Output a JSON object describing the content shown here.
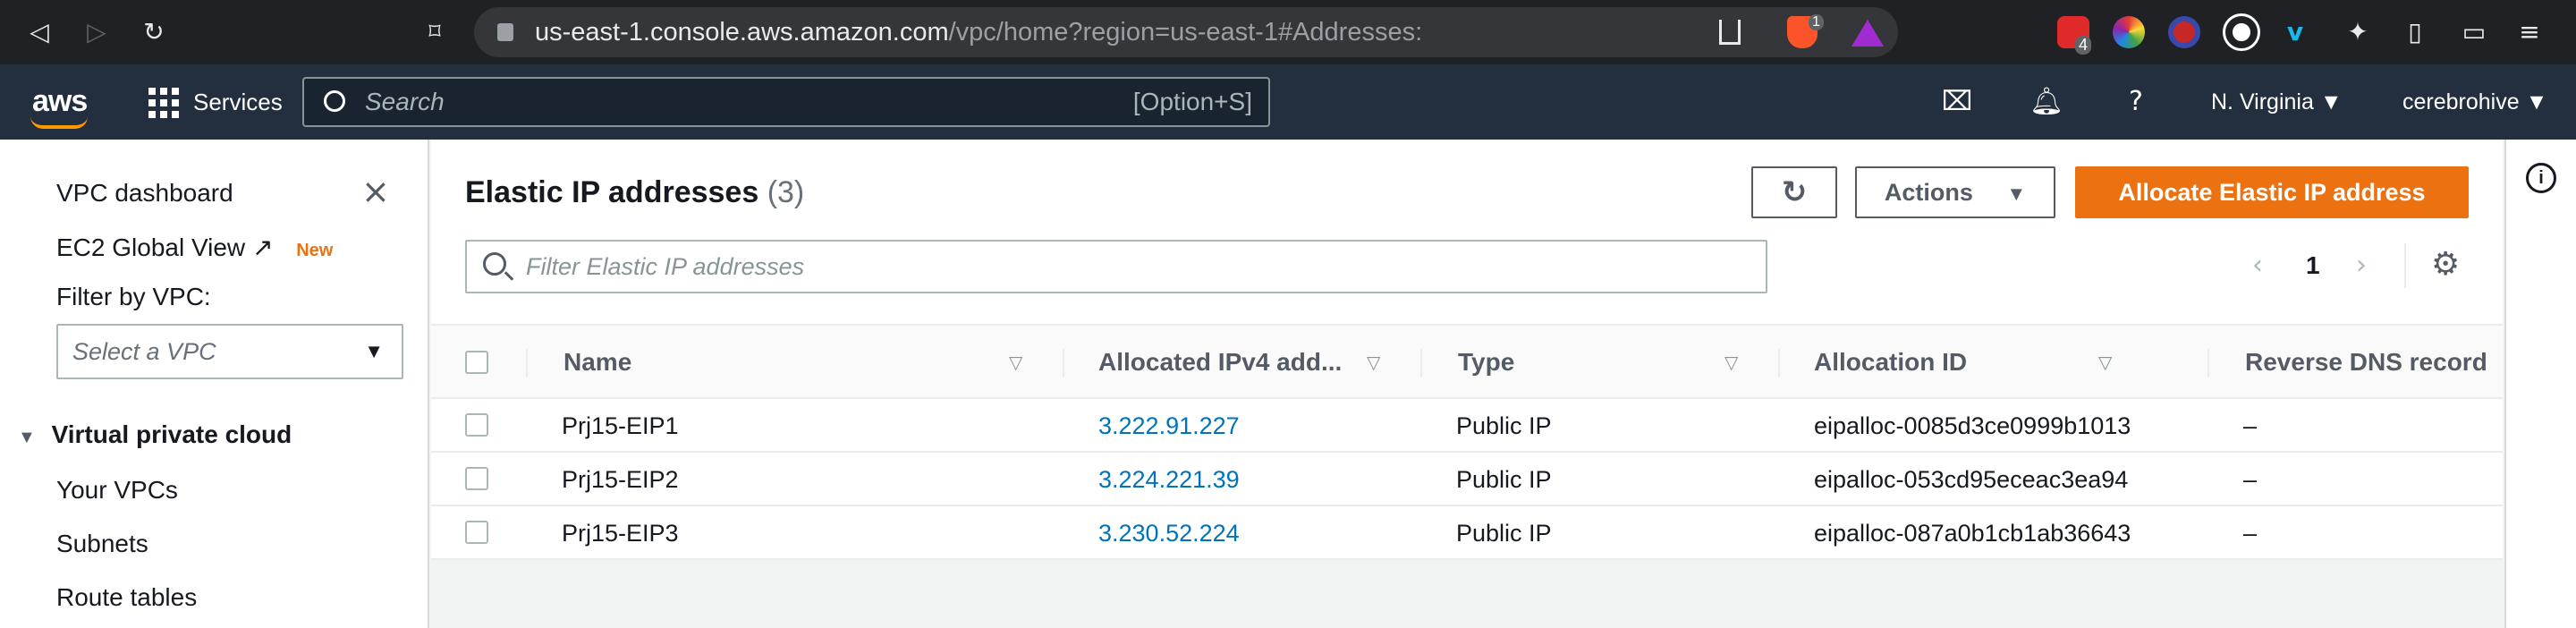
{
  "browser": {
    "url_host": "us-east-1.console.aws.amazon.com",
    "url_path": "/vpc/home?region=us-east-1#Addresses:",
    "extension_badge": "1",
    "extension_badge_2": "4"
  },
  "aws_header": {
    "logo_text": "aws",
    "services_label": "Services",
    "search_placeholder": "Search",
    "search_shortcut": "[Option+S]",
    "region": "N. Virginia ▼",
    "account": "cerebrohive ▼"
  },
  "sidebar": {
    "dashboard": "VPC dashboard",
    "global_view": "EC2 Global View",
    "new_badge": "New",
    "filter_label": "Filter by VPC:",
    "filter_placeholder": "Select a VPC",
    "section_title": "Virtual private cloud",
    "items": [
      "Your VPCs",
      "Subnets",
      "Route tables"
    ]
  },
  "main": {
    "title": "Elastic IP addresses",
    "count": "(3)",
    "actions_label": "Actions",
    "allocate_label": "Allocate Elastic IP address",
    "filter_placeholder": "Filter Elastic IP addresses",
    "page_number": "1",
    "columns": [
      "Name",
      "Allocated IPv4 add...",
      "Type",
      "Allocation ID",
      "Reverse DNS record"
    ],
    "rows": [
      {
        "name": "Prj15-EIP1",
        "ip": "3.222.91.227",
        "type": "Public IP",
        "allocation_id": "eipalloc-0085d3ce0999b1013",
        "reverse_dns": "–"
      },
      {
        "name": "Prj15-EIP2",
        "ip": "3.224.221.39",
        "type": "Public IP",
        "allocation_id": "eipalloc-053cd95eceac3ea94",
        "reverse_dns": "–"
      },
      {
        "name": "Prj15-EIP3",
        "ip": "3.230.52.224",
        "type": "Public IP",
        "allocation_id": "eipalloc-087a0b1cb1ab36643",
        "reverse_dns": "–"
      }
    ]
  },
  "colors": {
    "aws_nav": "#232f3e",
    "primary_button": "#ec7211",
    "link": "#0073bb"
  }
}
